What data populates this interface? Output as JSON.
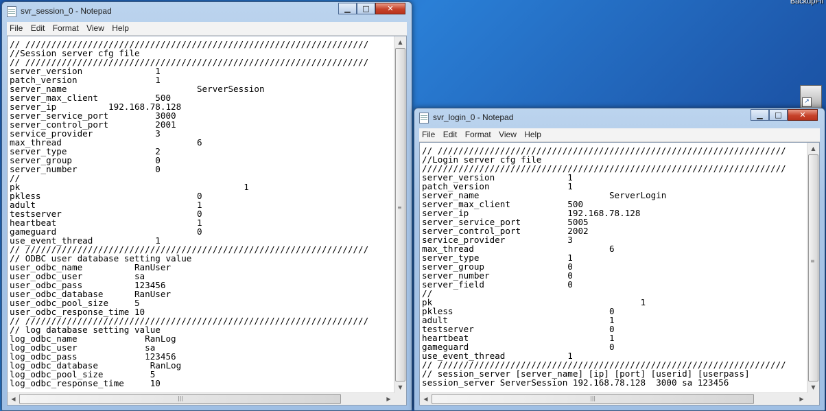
{
  "desktop": {
    "corner_label": "BackupFil"
  },
  "window_session": {
    "title": "svr_session_0 - Notepad",
    "menu": [
      "File",
      "Edit",
      "Format",
      "View",
      "Help"
    ],
    "content": "// //////////////////////////////////////////////////////////////////\n//Session server cfg file\n// //////////////////////////////////////////////////////////////////\nserver_version              1\npatch_version               1\nserver_name                         ServerSession\nserver_max_client           500\nserver_ip          192.168.78.128\nserver_service_port         3000\nserver_control_port         2001\nservice_provider            3\nmax_thread                          6\nserver_type                 2\nserver_group                0\nserver_number               0\n//\npk                                           1\npkless                              0\nadult                               1\ntestserver                          0\nheartbeat                           1\ngameguard                           0\nuse_event_thread            1\n// //////////////////////////////////////////////////////////////////\n// ODBC user database setting value\nuser_odbc_name          RanUser\nuser_odbc_user          sa\nuser_odbc_pass          123456\nuser_odbc_database      RanUser\nuser_odbc_pool_size     5\nuser_odbc_response_time 10\n// //////////////////////////////////////////////////////////////////\n// log database setting value\nlog_odbc_name             RanLog\nlog_odbc_user             sa\nlog_odbc_pass             123456\nlog_odbc_database          RanLog\nlog_odbc_pool_size         5\nlog_odbc_response_time     10"
  },
  "window_login": {
    "title": "svr_login_0 - Notepad",
    "menu": [
      "File",
      "Edit",
      "Format",
      "View",
      "Help"
    ],
    "content": "// ///////////////////////////////////////////////////////////////////\n//Login server cfg file\n//////////////////////////////////////////////////////////////////////\nserver_version              1\npatch_version               1\nserver_name                         ServerLogin\nserver_max_client           500\nserver_ip                   192.168.78.128\nserver_service_port         5005\nserver_control_port         2002\nservice_provider            3\nmax_thread                          6\nserver_type                 1\nserver_group                0\nserver_number               0\nserver_field                0\n//\npk                                        1\npkless                              0\nadult                               1\ntestserver                          0\nheartbeat                           1\ngameguard                           0\nuse_event_thread            1\n// ///////////////////////////////////////////////////////////////////\n// session_server [server_name] [ip] [port] [userid] [userpass]\nsession_server ServerSession 192.168.78.128  3000 sa 123456"
  }
}
